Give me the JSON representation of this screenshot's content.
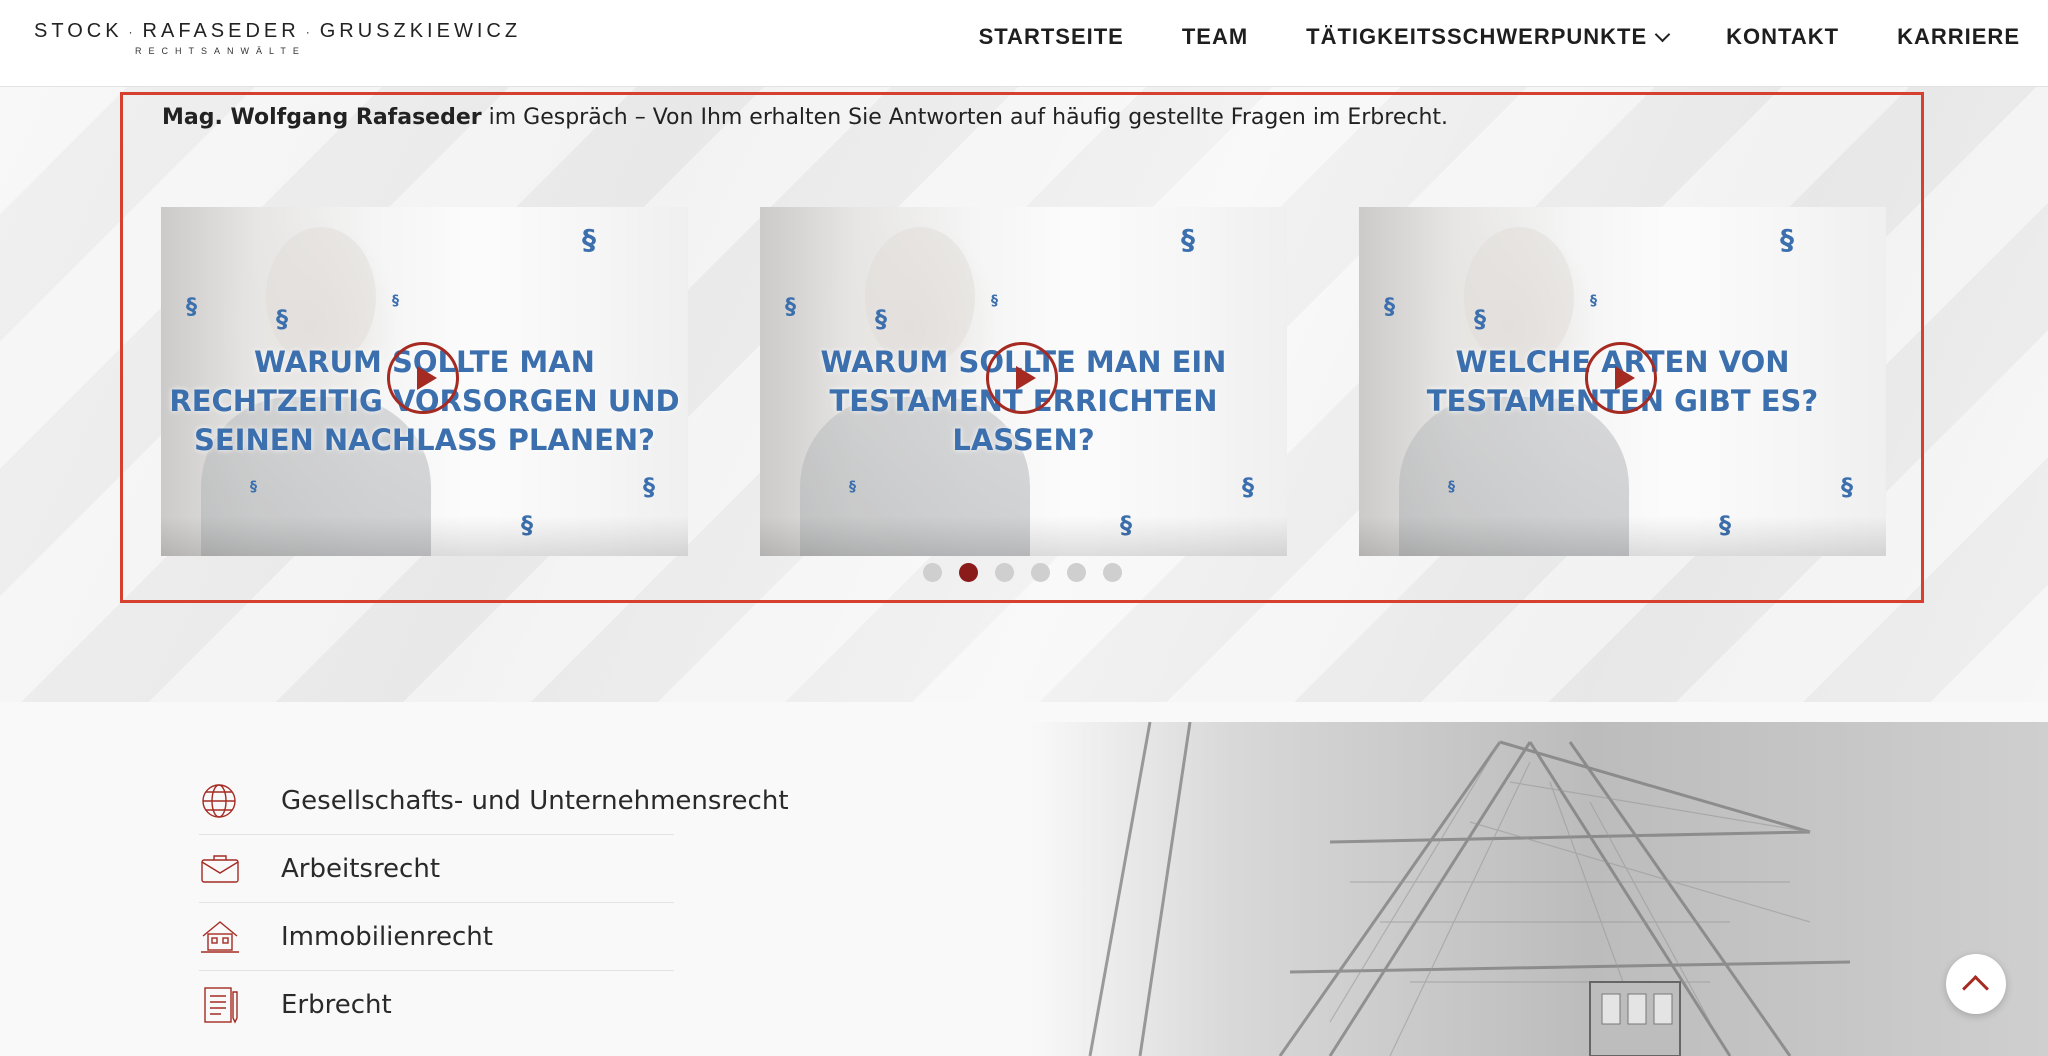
{
  "logo": {
    "name_parts": [
      "STOCK",
      "RAFASEDER",
      "GRUSZKIEWICZ"
    ],
    "separator": "·",
    "subtitle": "RECHTSANWÄLTE"
  },
  "nav": {
    "items": [
      {
        "label": "STARTSEITE"
      },
      {
        "label": "TEAM"
      },
      {
        "label": "TÄTIGKEITSSCHWERPUNKTE",
        "has_dropdown": true
      },
      {
        "label": "KONTAKT"
      },
      {
        "label": "KARRIERE"
      }
    ]
  },
  "intro": {
    "name": "Mag. Wolfgang Rafaseder",
    "text": " im Gespräch – Von Ihm erhalten Sie Antworten auf häufig gestellte Fragen im Erbrecht."
  },
  "videos": [
    {
      "title": "WARUM SOLLTE MAN RECHTZEITIG VORSORGEN UND SEINEN NACHLASS PLANEN?"
    },
    {
      "title": "WARUM SOLLTE MAN EIN TESTAMENT ERRICHTEN LASSEN?"
    },
    {
      "title": "WELCHE ARTEN VON TESTAMENTEN GIBT ES?"
    }
  ],
  "paragraph_symbol": "§",
  "carousel": {
    "dot_count": 6,
    "active_index": 1
  },
  "practice_areas": [
    {
      "label": "Gesellschafts- und Unternehmensrecht",
      "icon": "globe-icon"
    },
    {
      "label": "Arbeitsrecht",
      "icon": "briefcase-icon"
    },
    {
      "label": "Immobilienrecht",
      "icon": "house-icon"
    },
    {
      "label": "Erbrecht",
      "icon": "document-icon"
    }
  ],
  "colors": {
    "accent": "#a52a22",
    "frame": "#d6402f",
    "video_text": "#3b6fad",
    "dot_active": "#8b1a1a"
  }
}
